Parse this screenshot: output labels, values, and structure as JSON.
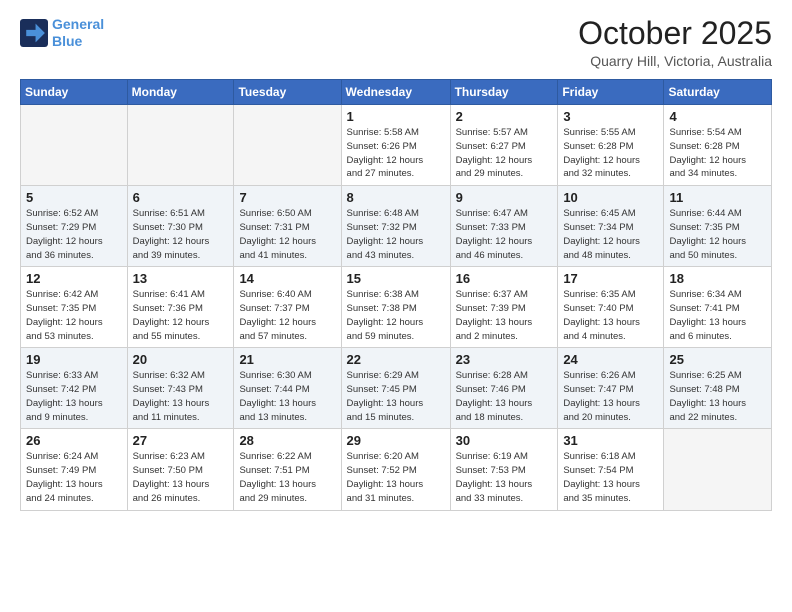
{
  "header": {
    "logo_line1": "General",
    "logo_line2": "Blue",
    "month": "October 2025",
    "location": "Quarry Hill, Victoria, Australia"
  },
  "weekdays": [
    "Sunday",
    "Monday",
    "Tuesday",
    "Wednesday",
    "Thursday",
    "Friday",
    "Saturday"
  ],
  "weeks": [
    [
      {
        "day": "",
        "info": ""
      },
      {
        "day": "",
        "info": ""
      },
      {
        "day": "",
        "info": ""
      },
      {
        "day": "1",
        "info": "Sunrise: 5:58 AM\nSunset: 6:26 PM\nDaylight: 12 hours\nand 27 minutes."
      },
      {
        "day": "2",
        "info": "Sunrise: 5:57 AM\nSunset: 6:27 PM\nDaylight: 12 hours\nand 29 minutes."
      },
      {
        "day": "3",
        "info": "Sunrise: 5:55 AM\nSunset: 6:28 PM\nDaylight: 12 hours\nand 32 minutes."
      },
      {
        "day": "4",
        "info": "Sunrise: 5:54 AM\nSunset: 6:28 PM\nDaylight: 12 hours\nand 34 minutes."
      }
    ],
    [
      {
        "day": "5",
        "info": "Sunrise: 6:52 AM\nSunset: 7:29 PM\nDaylight: 12 hours\nand 36 minutes."
      },
      {
        "day": "6",
        "info": "Sunrise: 6:51 AM\nSunset: 7:30 PM\nDaylight: 12 hours\nand 39 minutes."
      },
      {
        "day": "7",
        "info": "Sunrise: 6:50 AM\nSunset: 7:31 PM\nDaylight: 12 hours\nand 41 minutes."
      },
      {
        "day": "8",
        "info": "Sunrise: 6:48 AM\nSunset: 7:32 PM\nDaylight: 12 hours\nand 43 minutes."
      },
      {
        "day": "9",
        "info": "Sunrise: 6:47 AM\nSunset: 7:33 PM\nDaylight: 12 hours\nand 46 minutes."
      },
      {
        "day": "10",
        "info": "Sunrise: 6:45 AM\nSunset: 7:34 PM\nDaylight: 12 hours\nand 48 minutes."
      },
      {
        "day": "11",
        "info": "Sunrise: 6:44 AM\nSunset: 7:35 PM\nDaylight: 12 hours\nand 50 minutes."
      }
    ],
    [
      {
        "day": "12",
        "info": "Sunrise: 6:42 AM\nSunset: 7:35 PM\nDaylight: 12 hours\nand 53 minutes."
      },
      {
        "day": "13",
        "info": "Sunrise: 6:41 AM\nSunset: 7:36 PM\nDaylight: 12 hours\nand 55 minutes."
      },
      {
        "day": "14",
        "info": "Sunrise: 6:40 AM\nSunset: 7:37 PM\nDaylight: 12 hours\nand 57 minutes."
      },
      {
        "day": "15",
        "info": "Sunrise: 6:38 AM\nSunset: 7:38 PM\nDaylight: 12 hours\nand 59 minutes."
      },
      {
        "day": "16",
        "info": "Sunrise: 6:37 AM\nSunset: 7:39 PM\nDaylight: 13 hours\nand 2 minutes."
      },
      {
        "day": "17",
        "info": "Sunrise: 6:35 AM\nSunset: 7:40 PM\nDaylight: 13 hours\nand 4 minutes."
      },
      {
        "day": "18",
        "info": "Sunrise: 6:34 AM\nSunset: 7:41 PM\nDaylight: 13 hours\nand 6 minutes."
      }
    ],
    [
      {
        "day": "19",
        "info": "Sunrise: 6:33 AM\nSunset: 7:42 PM\nDaylight: 13 hours\nand 9 minutes."
      },
      {
        "day": "20",
        "info": "Sunrise: 6:32 AM\nSunset: 7:43 PM\nDaylight: 13 hours\nand 11 minutes."
      },
      {
        "day": "21",
        "info": "Sunrise: 6:30 AM\nSunset: 7:44 PM\nDaylight: 13 hours\nand 13 minutes."
      },
      {
        "day": "22",
        "info": "Sunrise: 6:29 AM\nSunset: 7:45 PM\nDaylight: 13 hours\nand 15 minutes."
      },
      {
        "day": "23",
        "info": "Sunrise: 6:28 AM\nSunset: 7:46 PM\nDaylight: 13 hours\nand 18 minutes."
      },
      {
        "day": "24",
        "info": "Sunrise: 6:26 AM\nSunset: 7:47 PM\nDaylight: 13 hours\nand 20 minutes."
      },
      {
        "day": "25",
        "info": "Sunrise: 6:25 AM\nSunset: 7:48 PM\nDaylight: 13 hours\nand 22 minutes."
      }
    ],
    [
      {
        "day": "26",
        "info": "Sunrise: 6:24 AM\nSunset: 7:49 PM\nDaylight: 13 hours\nand 24 minutes."
      },
      {
        "day": "27",
        "info": "Sunrise: 6:23 AM\nSunset: 7:50 PM\nDaylight: 13 hours\nand 26 minutes."
      },
      {
        "day": "28",
        "info": "Sunrise: 6:22 AM\nSunset: 7:51 PM\nDaylight: 13 hours\nand 29 minutes."
      },
      {
        "day": "29",
        "info": "Sunrise: 6:20 AM\nSunset: 7:52 PM\nDaylight: 13 hours\nand 31 minutes."
      },
      {
        "day": "30",
        "info": "Sunrise: 6:19 AM\nSunset: 7:53 PM\nDaylight: 13 hours\nand 33 minutes."
      },
      {
        "day": "31",
        "info": "Sunrise: 6:18 AM\nSunset: 7:54 PM\nDaylight: 13 hours\nand 35 minutes."
      },
      {
        "day": "",
        "info": ""
      }
    ]
  ]
}
